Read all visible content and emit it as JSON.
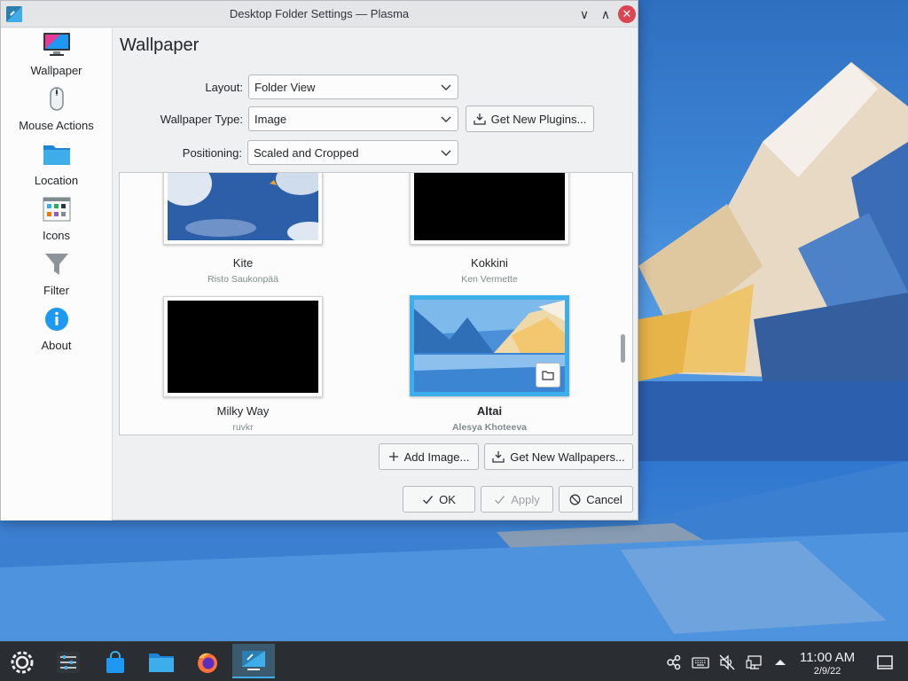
{
  "window": {
    "title": "Desktop Folder Settings — Plasma",
    "minimize_glyph": "∨",
    "maximize_glyph": "∧",
    "close_glyph": "✕"
  },
  "sidebar": {
    "items": [
      {
        "label": "Wallpaper",
        "icon": "monitor-icon"
      },
      {
        "label": "Mouse Actions",
        "icon": "mouse-icon"
      },
      {
        "label": "Location",
        "icon": "folder-icon"
      },
      {
        "label": "Icons",
        "icon": "icons-grid-icon"
      },
      {
        "label": "Filter",
        "icon": "filter-icon"
      },
      {
        "label": "About",
        "icon": "info-icon"
      }
    ]
  },
  "page": {
    "title": "Wallpaper",
    "layout_label": "Layout:",
    "layout_value": "Folder View",
    "type_label": "Wallpaper Type:",
    "type_value": "Image",
    "get_plugins": "Get New Plugins...",
    "positioning_label": "Positioning:",
    "positioning_value": "Scaled and Cropped"
  },
  "wallpapers": [
    {
      "name": "Kite",
      "author": "Risto Saukonpää"
    },
    {
      "name": "Kokkini",
      "author": "Ken Vermette"
    },
    {
      "name": "Milky Way",
      "author": "ruvkr"
    },
    {
      "name": "Altai",
      "author": "Alesya Khoteeva",
      "selected": true
    }
  ],
  "actions": {
    "add_image": "Add Image...",
    "get_wallpapers": "Get New Wallpapers...",
    "ok": "OK",
    "apply": "Apply",
    "cancel": "Cancel"
  },
  "taskbar": {
    "time": "11:00 AM",
    "date": "2/9/22"
  },
  "colors": {
    "accent": "#3daee9",
    "close": "#da4453",
    "panel": "#2a2e32"
  }
}
